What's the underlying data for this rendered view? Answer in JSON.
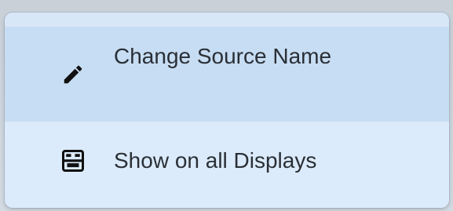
{
  "menu": {
    "items": [
      {
        "label": "Change Source Name",
        "icon": "pencil-icon",
        "highlighted": true
      },
      {
        "label": "Show on all Displays",
        "icon": "displays-icon",
        "highlighted": false
      }
    ]
  },
  "colors": {
    "menu_background": "#dcebfb",
    "highlight_background": "#c7ddf3",
    "text": "#2a2f36",
    "icon": "#111111"
  }
}
